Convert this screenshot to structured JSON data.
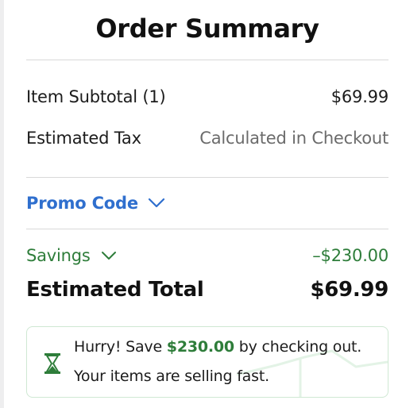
{
  "title": "Order Summary",
  "rows": {
    "subtotal": {
      "label": "Item Subtotal (1)",
      "value": "$69.99"
    },
    "tax": {
      "label": "Estimated Tax",
      "value": "Calculated in Checkout"
    }
  },
  "promo": {
    "label": "Promo Code",
    "icon": "chevron-down-icon"
  },
  "savings": {
    "label": "Savings",
    "value": "–$230.00",
    "icon": "chevron-down-icon"
  },
  "total": {
    "label": "Estimated Total",
    "value": "$69.99"
  },
  "hurry": {
    "prefix": "Hurry! Save ",
    "amount": "$230.00",
    "suffix": " by checking out.",
    "line2": "Your items are selling fast.",
    "icon": "hourglass-icon"
  },
  "colors": {
    "accent_blue": "#2f6fce",
    "savings_green": "#2e7d3a",
    "divider": "#d9d9d9",
    "banner_border": "#cfe8d3"
  }
}
